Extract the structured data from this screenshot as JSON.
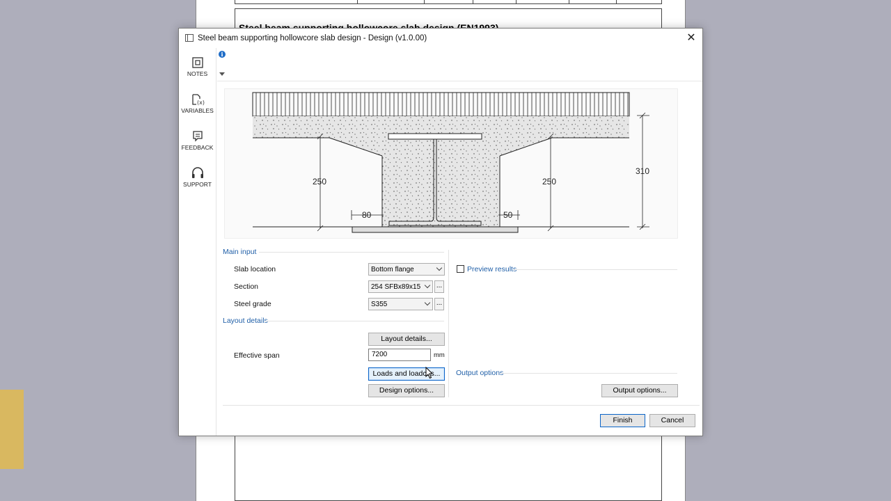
{
  "background": {
    "doc_heading": "Steel beam supporting hollowcore slab design (EN1993)"
  },
  "dialog": {
    "title": "Steel beam supporting hollowcore slab design - Design (v1.0.00)",
    "close_glyph": "✕"
  },
  "sidebar": {
    "items": [
      {
        "label": "NOTES",
        "icon": "notes-icon"
      },
      {
        "label": "VARIABLES",
        "icon": "variables-icon"
      },
      {
        "label": "FEEDBACK",
        "icon": "feedback-icon"
      },
      {
        "label": "SUPPORT",
        "icon": "support-icon"
      }
    ]
  },
  "diagram": {
    "dim_left_height": "250",
    "dim_right_height": "250",
    "dim_total_height": "310",
    "dim_left_bearing": "80",
    "dim_right_bearing": "50"
  },
  "main_input": {
    "heading": "Main input",
    "slab_location_label": "Slab location",
    "slab_location_value": "Bottom flange",
    "section_label": "Section",
    "section_value": "254 SFBx89x15",
    "steel_grade_label": "Steel grade",
    "steel_grade_value": "S355",
    "dots": "..."
  },
  "layout": {
    "heading": "Layout details",
    "layout_button": "Layout details...",
    "effective_span_label": "Effective span",
    "effective_span_value": "7200",
    "effective_span_unit": "mm",
    "loads_button": "Loads and loadcas...",
    "design_button": "Design options..."
  },
  "results": {
    "preview_label": "Preview results"
  },
  "output": {
    "heading": "Output options",
    "output_button": "Output options..."
  },
  "footer": {
    "finish": "Finish",
    "cancel": "Cancel"
  }
}
